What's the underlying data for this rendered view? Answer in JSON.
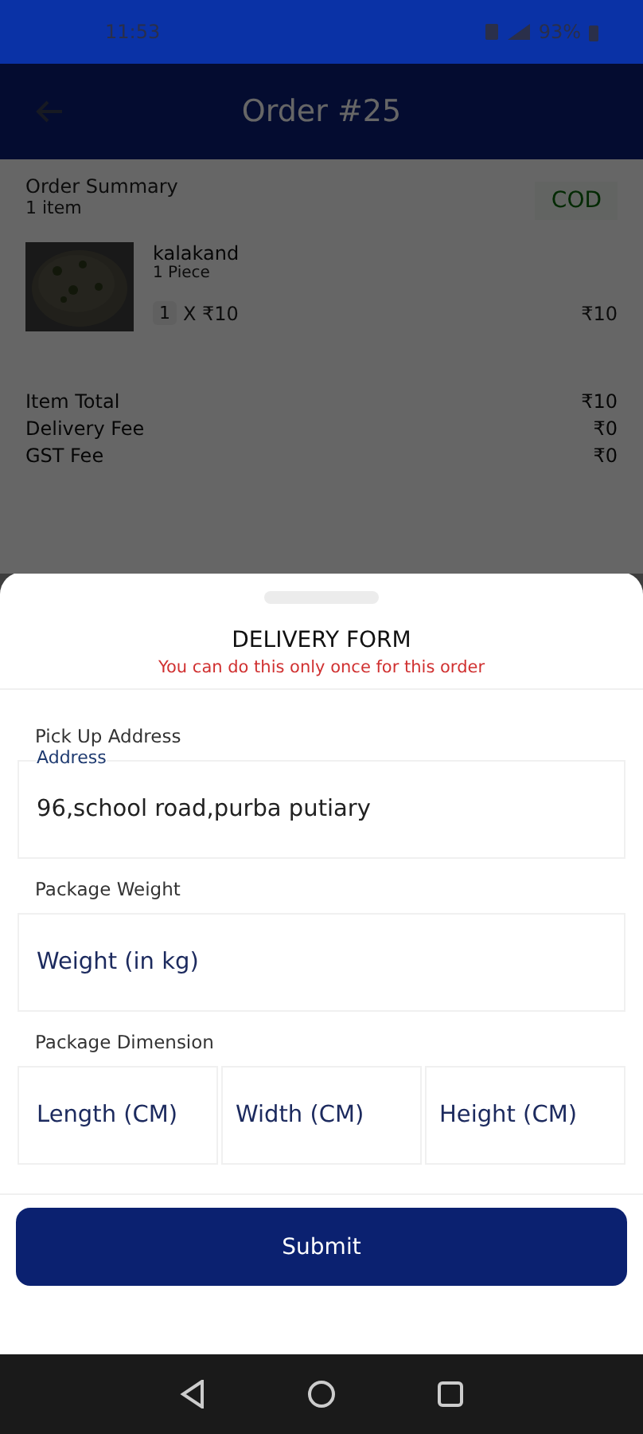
{
  "status_bar": {
    "time": "11:53",
    "battery": "93%"
  },
  "header": {
    "title": "Order #25"
  },
  "order_summary": {
    "title": "Order Summary",
    "count": "1 item",
    "payment": "COD",
    "items": [
      {
        "name": "kalakand",
        "unit": "1 Piece",
        "quantity": "1",
        "price_line": "X ₹10",
        "total": "₹10"
      }
    ],
    "fees": [
      {
        "label": "Item Total",
        "value": "₹10"
      },
      {
        "label": "Delivery Fee",
        "value": "₹0"
      },
      {
        "label": "GST Fee",
        "value": "₹0"
      }
    ]
  },
  "delivery_form": {
    "title": "DELIVERY FORM",
    "warning": "You can do this only once for this order",
    "sections": [
      {
        "label": "Pick Up Address",
        "fields": [
          {
            "label": "Address",
            "value": "96,school road,purba putiary"
          }
        ]
      },
      {
        "label": "Package Weight",
        "fields": [
          {
            "placeholder": "Weight (in kg)"
          }
        ]
      },
      {
        "label": "Package Dimension",
        "fields": [
          {
            "placeholder": "Length (CM)"
          },
          {
            "placeholder": "Width (CM)"
          },
          {
            "placeholder": "Height (CM)"
          }
        ]
      }
    ],
    "submit": "Submit"
  }
}
